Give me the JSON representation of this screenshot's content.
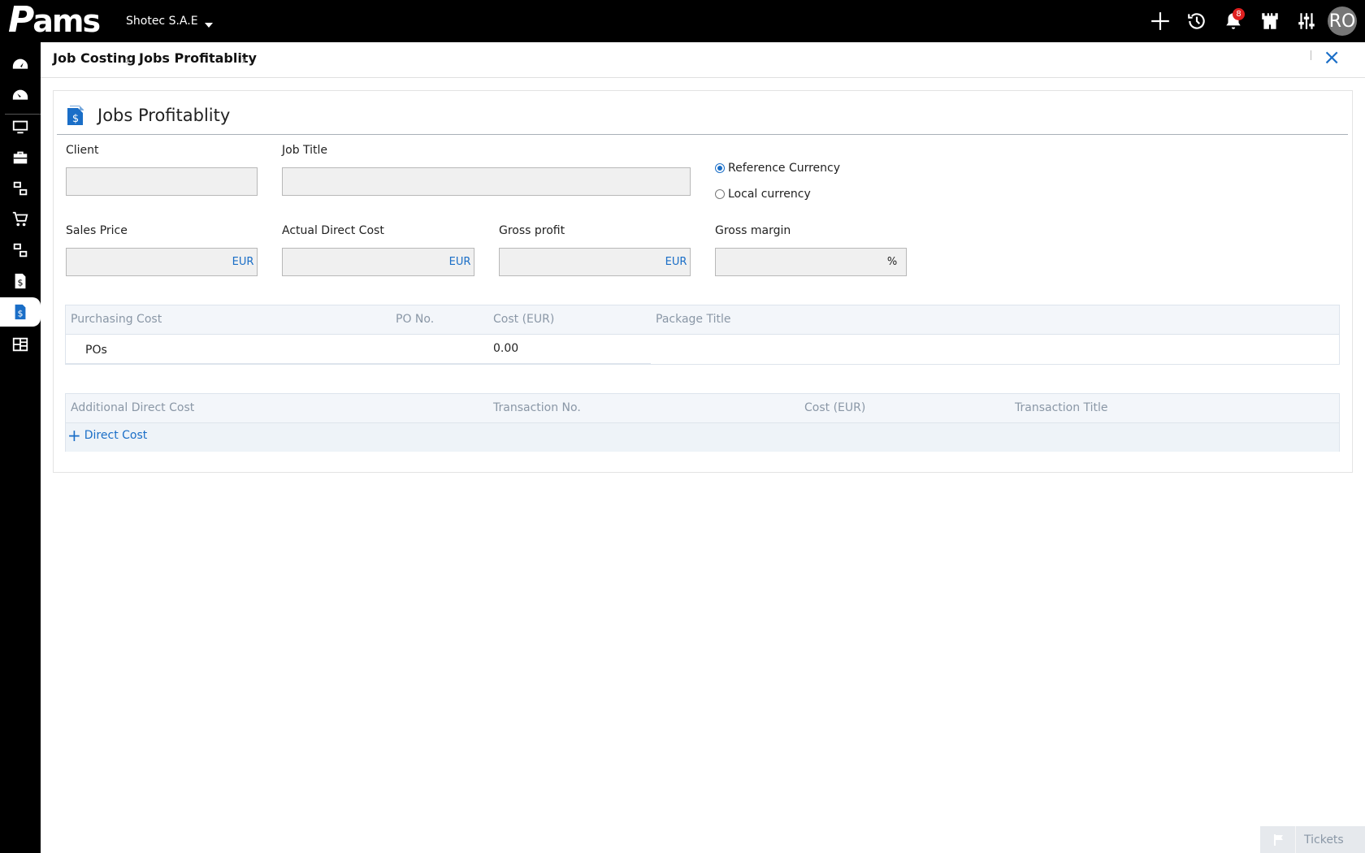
{
  "app": {
    "logo_text": "ams",
    "company": "Shotec S.A.E"
  },
  "topbar": {
    "notifications_count": "8",
    "avatar_initials": "RO"
  },
  "breadcrumb": {
    "items": [
      "Job Costing",
      "Jobs Profitablity"
    ]
  },
  "panel": {
    "title": "Jobs Profitablity"
  },
  "form": {
    "client_label": "Client",
    "job_title_label": "Job Title",
    "reference_currency_label": "Reference Currency",
    "local_currency_label": "Local currency",
    "reference_currency_selected": true,
    "sales_price_label": "Sales Price",
    "actual_direct_cost_label": "Actual Direct Cost",
    "gross_profit_label": "Gross profit",
    "gross_margin_label": "Gross margin",
    "currency_suffix": "EUR",
    "percent_suffix": "%"
  },
  "purchasing_table": {
    "headers": [
      "Purchasing Cost",
      "PO No.",
      "Cost (EUR)",
      "Package Title"
    ],
    "row": {
      "label": "POs",
      "cost": "0.00"
    }
  },
  "direct_cost_table": {
    "headers": [
      "Additional Direct Cost",
      "Transaction No.",
      "Cost (EUR)",
      "Transaction Title"
    ],
    "add_label": "Direct Cost"
  },
  "tickets": {
    "label": "Tickets"
  },
  "colors": {
    "accent": "#1a6ec7",
    "topbar": "#000000",
    "badge": "#e02020"
  }
}
